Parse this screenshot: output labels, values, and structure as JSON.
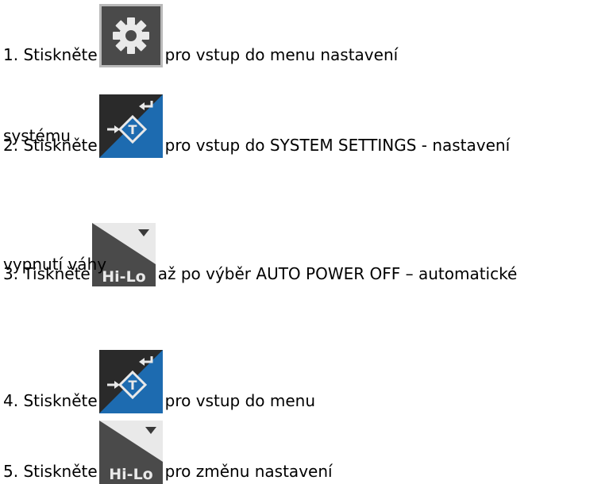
{
  "steps": [
    {
      "prefix": "1. Stiskněte",
      "icon": "gear-settings-key-icon",
      "suffix": "pro vstup do menu nastavení",
      "continuation": ""
    },
    {
      "prefix": "2. Stiskněte",
      "icon": "tare-enter-key-icon",
      "suffix": "pro vstup do SYSTEM SETTINGS  - nastavení",
      "continuation": "systému"
    },
    {
      "prefix": "3. Tiskněte",
      "icon": "hi-lo-down-key-icon",
      "suffix": "až po výběr AUTO POWER OFF – automatické",
      "continuation": "vypnutí váhy"
    },
    {
      "prefix": "4. Stiskněte",
      "icon": "tare-enter-key-icon",
      "suffix": "pro vstup do menu",
      "continuation": ""
    },
    {
      "prefix": "5. Stiskněte",
      "icon": "hi-lo-down-key-icon",
      "suffix": "pro změnu nastavení",
      "continuation": ""
    }
  ],
  "keys": {
    "hilo_label": "Hi-Lo"
  },
  "colors": {
    "key_gray": "#4a4a4a",
    "key_blue": "#1d6bb0",
    "key_light": "#e9e9e9",
    "text": "#000000"
  }
}
